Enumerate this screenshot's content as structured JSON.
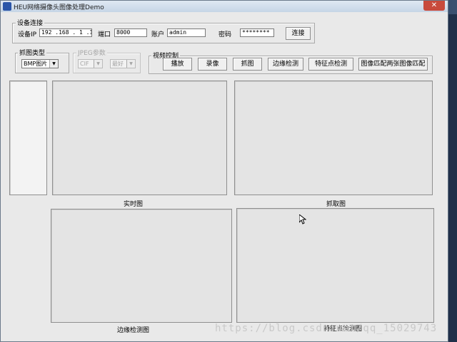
{
  "window": {
    "title": "HEU网络摄像头图像处理Demo",
    "close_glyph": "✕"
  },
  "connection": {
    "legend": "设备连接",
    "ip_label": "设备IP",
    "ip_value": "192 .168 . 1  .125",
    "port_label": "端口",
    "port_value": "8000",
    "user_label": "账户",
    "user_value": "admin",
    "password_label": "密码",
    "password_value": "********",
    "connect_button": "连接"
  },
  "capture_type": {
    "legend": "抓图类型",
    "selected": "BMP图片",
    "arrow": "▼"
  },
  "jpeg_params": {
    "legend": "JPEG参数",
    "resolution": "CIF",
    "quality": "最好",
    "arrow": "▼"
  },
  "video_control": {
    "legend": "视频控制",
    "buttons": [
      "播放",
      "录像",
      "抓图",
      "边缘检测",
      "特征点检测",
      "图像匹配两张图像匹配"
    ]
  },
  "panels": {
    "realtime_caption": "实时图",
    "capture_caption": "抓取图",
    "edge_caption": "边缘检测图",
    "feature_caption": "特征点检测图"
  },
  "watermark": "https://blog.csdn.net/qq_15029743",
  "colors": {
    "window_bg": "#e9e9e9",
    "titlebar": "#c6d5e6",
    "close": "#c84a3c"
  }
}
